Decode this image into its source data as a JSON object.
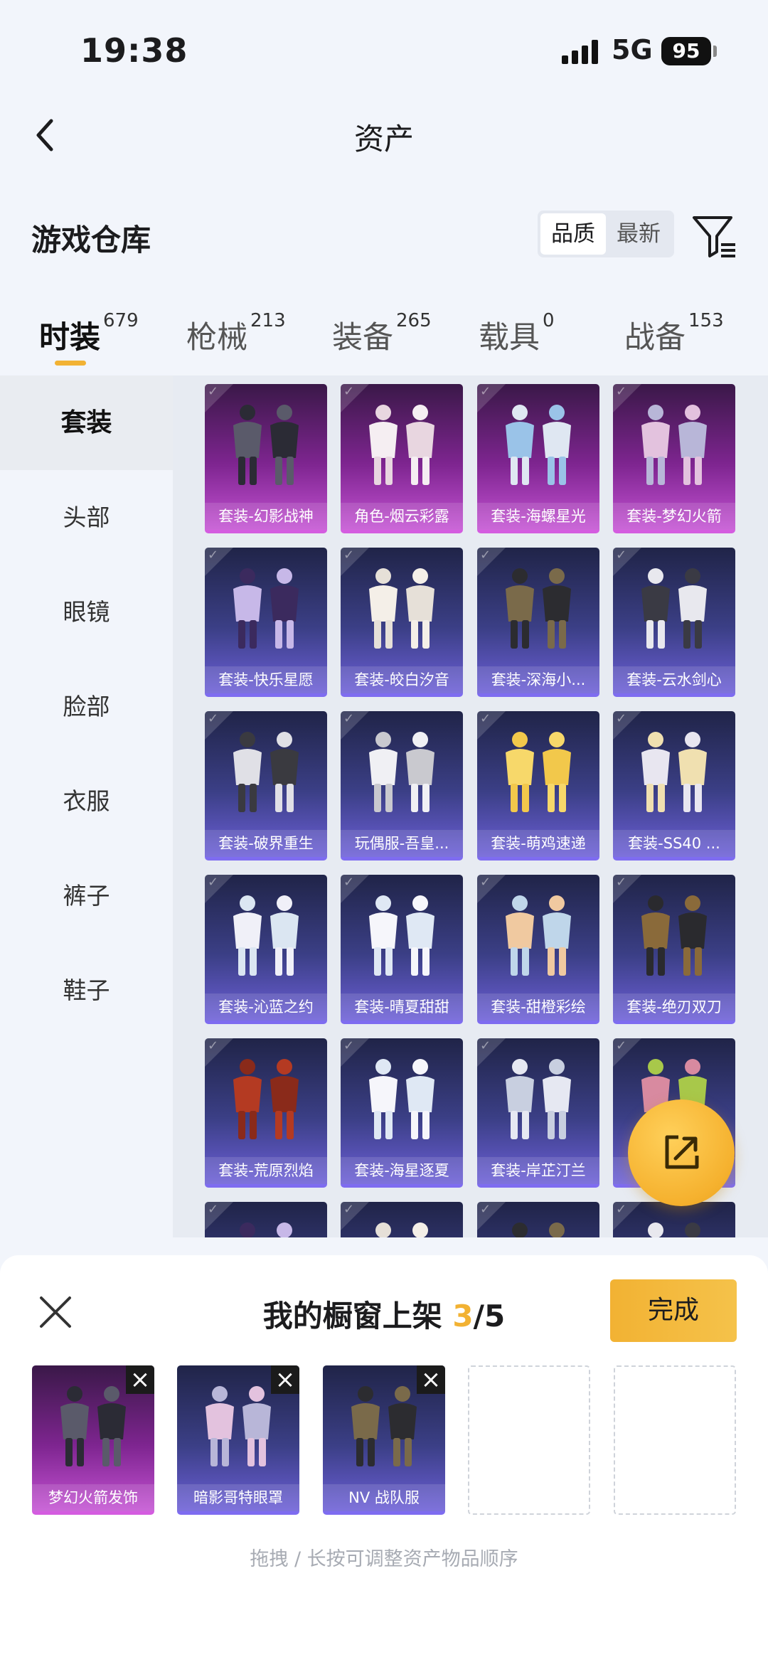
{
  "status": {
    "time": "19:38",
    "network": "5G",
    "battery": "95"
  },
  "nav": {
    "title": "资产",
    "back_icon": "chevron-left-icon"
  },
  "section": {
    "title": "游戏仓库",
    "sort_options": [
      "品质",
      "最新"
    ],
    "active_sort": "品质",
    "filter_icon": "filter-icon"
  },
  "tabs": [
    {
      "label": "时装",
      "count": "679",
      "active": true
    },
    {
      "label": "枪械",
      "count": "213"
    },
    {
      "label": "装备",
      "count": "265"
    },
    {
      "label": "载具",
      "count": "0"
    },
    {
      "label": "战备",
      "count": "153"
    }
  ],
  "categories": [
    {
      "label": "套装",
      "active": true
    },
    {
      "label": "头部"
    },
    {
      "label": "眼镜"
    },
    {
      "label": "脸部"
    },
    {
      "label": "衣服"
    },
    {
      "label": "裤子"
    },
    {
      "label": "鞋子"
    }
  ],
  "items": [
    {
      "name": "套装-幻影战神",
      "rarity": "purple"
    },
    {
      "name": "角色-烟云彩露",
      "rarity": "purple"
    },
    {
      "name": "套装-海螺星光",
      "rarity": "purple"
    },
    {
      "name": "套装-梦幻火箭",
      "rarity": "purple"
    },
    {
      "name": "套装-快乐星愿",
      "rarity": "blue"
    },
    {
      "name": "套装-皎白汐音",
      "rarity": "blue"
    },
    {
      "name": "套装-深海小...",
      "rarity": "blue"
    },
    {
      "name": "套装-云水剑心",
      "rarity": "blue"
    },
    {
      "name": "套装-破界重生",
      "rarity": "blue"
    },
    {
      "name": "玩偶服-吾皇...",
      "rarity": "blue"
    },
    {
      "name": "套装-萌鸡速递",
      "rarity": "blue"
    },
    {
      "name": "套装-SS40 ...",
      "rarity": "blue"
    },
    {
      "name": "套装-沁蓝之约",
      "rarity": "blue"
    },
    {
      "name": "套装-晴夏甜甜",
      "rarity": "blue"
    },
    {
      "name": "套装-甜橙彩绘",
      "rarity": "blue"
    },
    {
      "name": "套装-绝刃双刀",
      "rarity": "blue"
    },
    {
      "name": "套装-荒原烈焰",
      "rarity": "blue"
    },
    {
      "name": "套装-海星逐夏",
      "rarity": "blue"
    },
    {
      "name": "套装-岸芷汀兰",
      "rarity": "blue"
    },
    {
      "name": "套",
      "rarity": "blue"
    }
  ],
  "fab": {
    "icon": "share-export-icon"
  },
  "sheet": {
    "title": "我的橱窗上架",
    "count": "3",
    "total": "/5",
    "done_label": "完成",
    "close_icon": "close-icon",
    "slots": [
      {
        "name": "梦幻火箭发饰",
        "rarity": "purple"
      },
      {
        "name": "暗影哥特眼罩",
        "rarity": "blue"
      },
      {
        "name": "NV 战队服",
        "rarity": "blue"
      }
    ],
    "empty_slots": 2,
    "hint": "拖拽 / 长按可调整资产物品顺序"
  }
}
